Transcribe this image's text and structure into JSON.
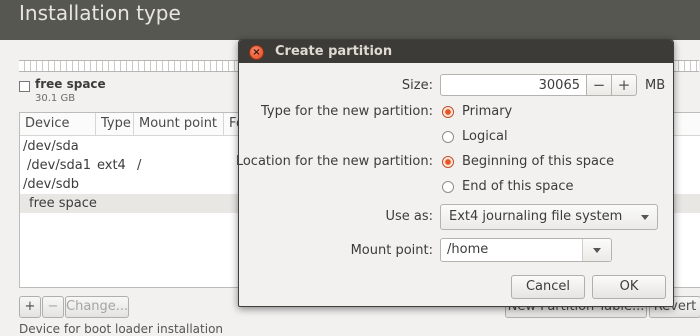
{
  "window": {
    "title": "Installation type"
  },
  "partition_bar": {
    "legend": {
      "name": "free space",
      "size": "30.1 GB"
    }
  },
  "tree": {
    "columns": [
      "Device",
      "Type",
      "Mount point",
      "Fo"
    ],
    "rows": [
      {
        "device": "/dev/sda",
        "type": "",
        "mount": ""
      },
      {
        "device": "/dev/sda1",
        "type": "ext4",
        "mount": "/"
      },
      {
        "device": "/dev/sdb",
        "type": "",
        "mount": ""
      },
      {
        "device": "free space",
        "type": "",
        "mount": ""
      }
    ]
  },
  "bottom": {
    "add": "+",
    "remove": "−",
    "change": "Change...",
    "new_table": "New Partition Table...",
    "revert": "Revert",
    "footnote": "Device for boot loader installation"
  },
  "dialog": {
    "title": "Create partition",
    "size_label": "Size:",
    "size_value": "30065",
    "minus": "−",
    "plus": "+",
    "size_unit": "MB",
    "type_label": "Type for the new partition:",
    "type_primary": "Primary",
    "type_logical": "Logical",
    "location_label": "Location for the new partition:",
    "loc_begin": "Beginning of this space",
    "loc_end": "End of this space",
    "use_as_label": "Use as:",
    "use_as_value": "Ext4 journaling file system",
    "mount_label": "Mount point:",
    "mount_value": "/home",
    "cancel": "Cancel",
    "ok": "OK"
  },
  "colors": {
    "accent": "#e95420",
    "titlebar": "#575751",
    "dialog_titlebar": "#3c3b37"
  }
}
